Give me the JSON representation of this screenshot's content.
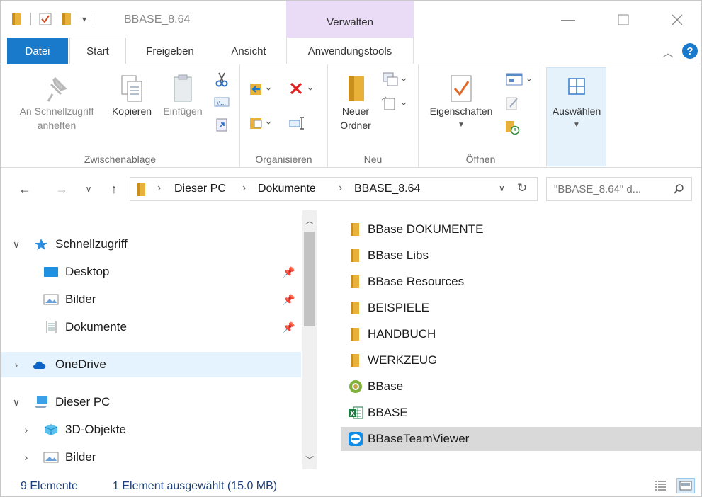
{
  "window": {
    "title": "BBASE_8.64",
    "contextual_group": "Verwalten"
  },
  "ribbon_tabs": {
    "file": "Datei",
    "start": "Start",
    "share": "Freigeben",
    "view": "Ansicht",
    "app_tools": "Anwendungstools"
  },
  "ribbon": {
    "clipboard": {
      "label": "Zwischenablage",
      "pin_line1": "An Schnellzugriff",
      "pin_line2": "anheften",
      "copy": "Kopieren",
      "paste": "Einfügen"
    },
    "organize": {
      "label": "Organisieren"
    },
    "new": {
      "label": "Neu",
      "new_folder_line1": "Neuer",
      "new_folder_line2": "Ordner"
    },
    "open": {
      "label": "Öffnen",
      "properties": "Eigenschaften"
    },
    "select": {
      "label": "Auswählen"
    }
  },
  "address": {
    "crumbs": [
      "Dieser PC",
      "Dokumente",
      "BBASE_8.64"
    ],
    "search_placeholder": "\"BBASE_8.64\" d..."
  },
  "nav_pane": {
    "quick_access": "Schnellzugriff",
    "desktop": "Desktop",
    "pictures": "Bilder",
    "documents": "Dokumente",
    "onedrive": "OneDrive",
    "this_pc": "Dieser PC",
    "objects3d": "3D-Objekte",
    "pictures_pc": "Bilder"
  },
  "files": [
    {
      "name": "BBase DOKUMENTE",
      "icon": "folder-icon"
    },
    {
      "name": "BBase Libs",
      "icon": "folder-icon"
    },
    {
      "name": "BBase Resources",
      "icon": "folder-icon"
    },
    {
      "name": "BEISPIELE",
      "icon": "folder-icon"
    },
    {
      "name": "HANDBUCH",
      "icon": "folder-icon"
    },
    {
      "name": "WERKZEUG",
      "icon": "folder-icon"
    },
    {
      "name": "BBase",
      "icon": "bbase-app-icon"
    },
    {
      "name": "BBASE",
      "icon": "excel-icon"
    },
    {
      "name": "BBaseTeamViewer",
      "icon": "teamviewer-icon"
    }
  ],
  "status": {
    "count": "9 Elemente",
    "selection": "1 Element ausgewählt (15.0 MB)"
  },
  "colors": {
    "accent": "#1979ca",
    "contextual": "#eadcf7",
    "folder": "#e8b23a",
    "status_text": "#1e3f7a"
  }
}
